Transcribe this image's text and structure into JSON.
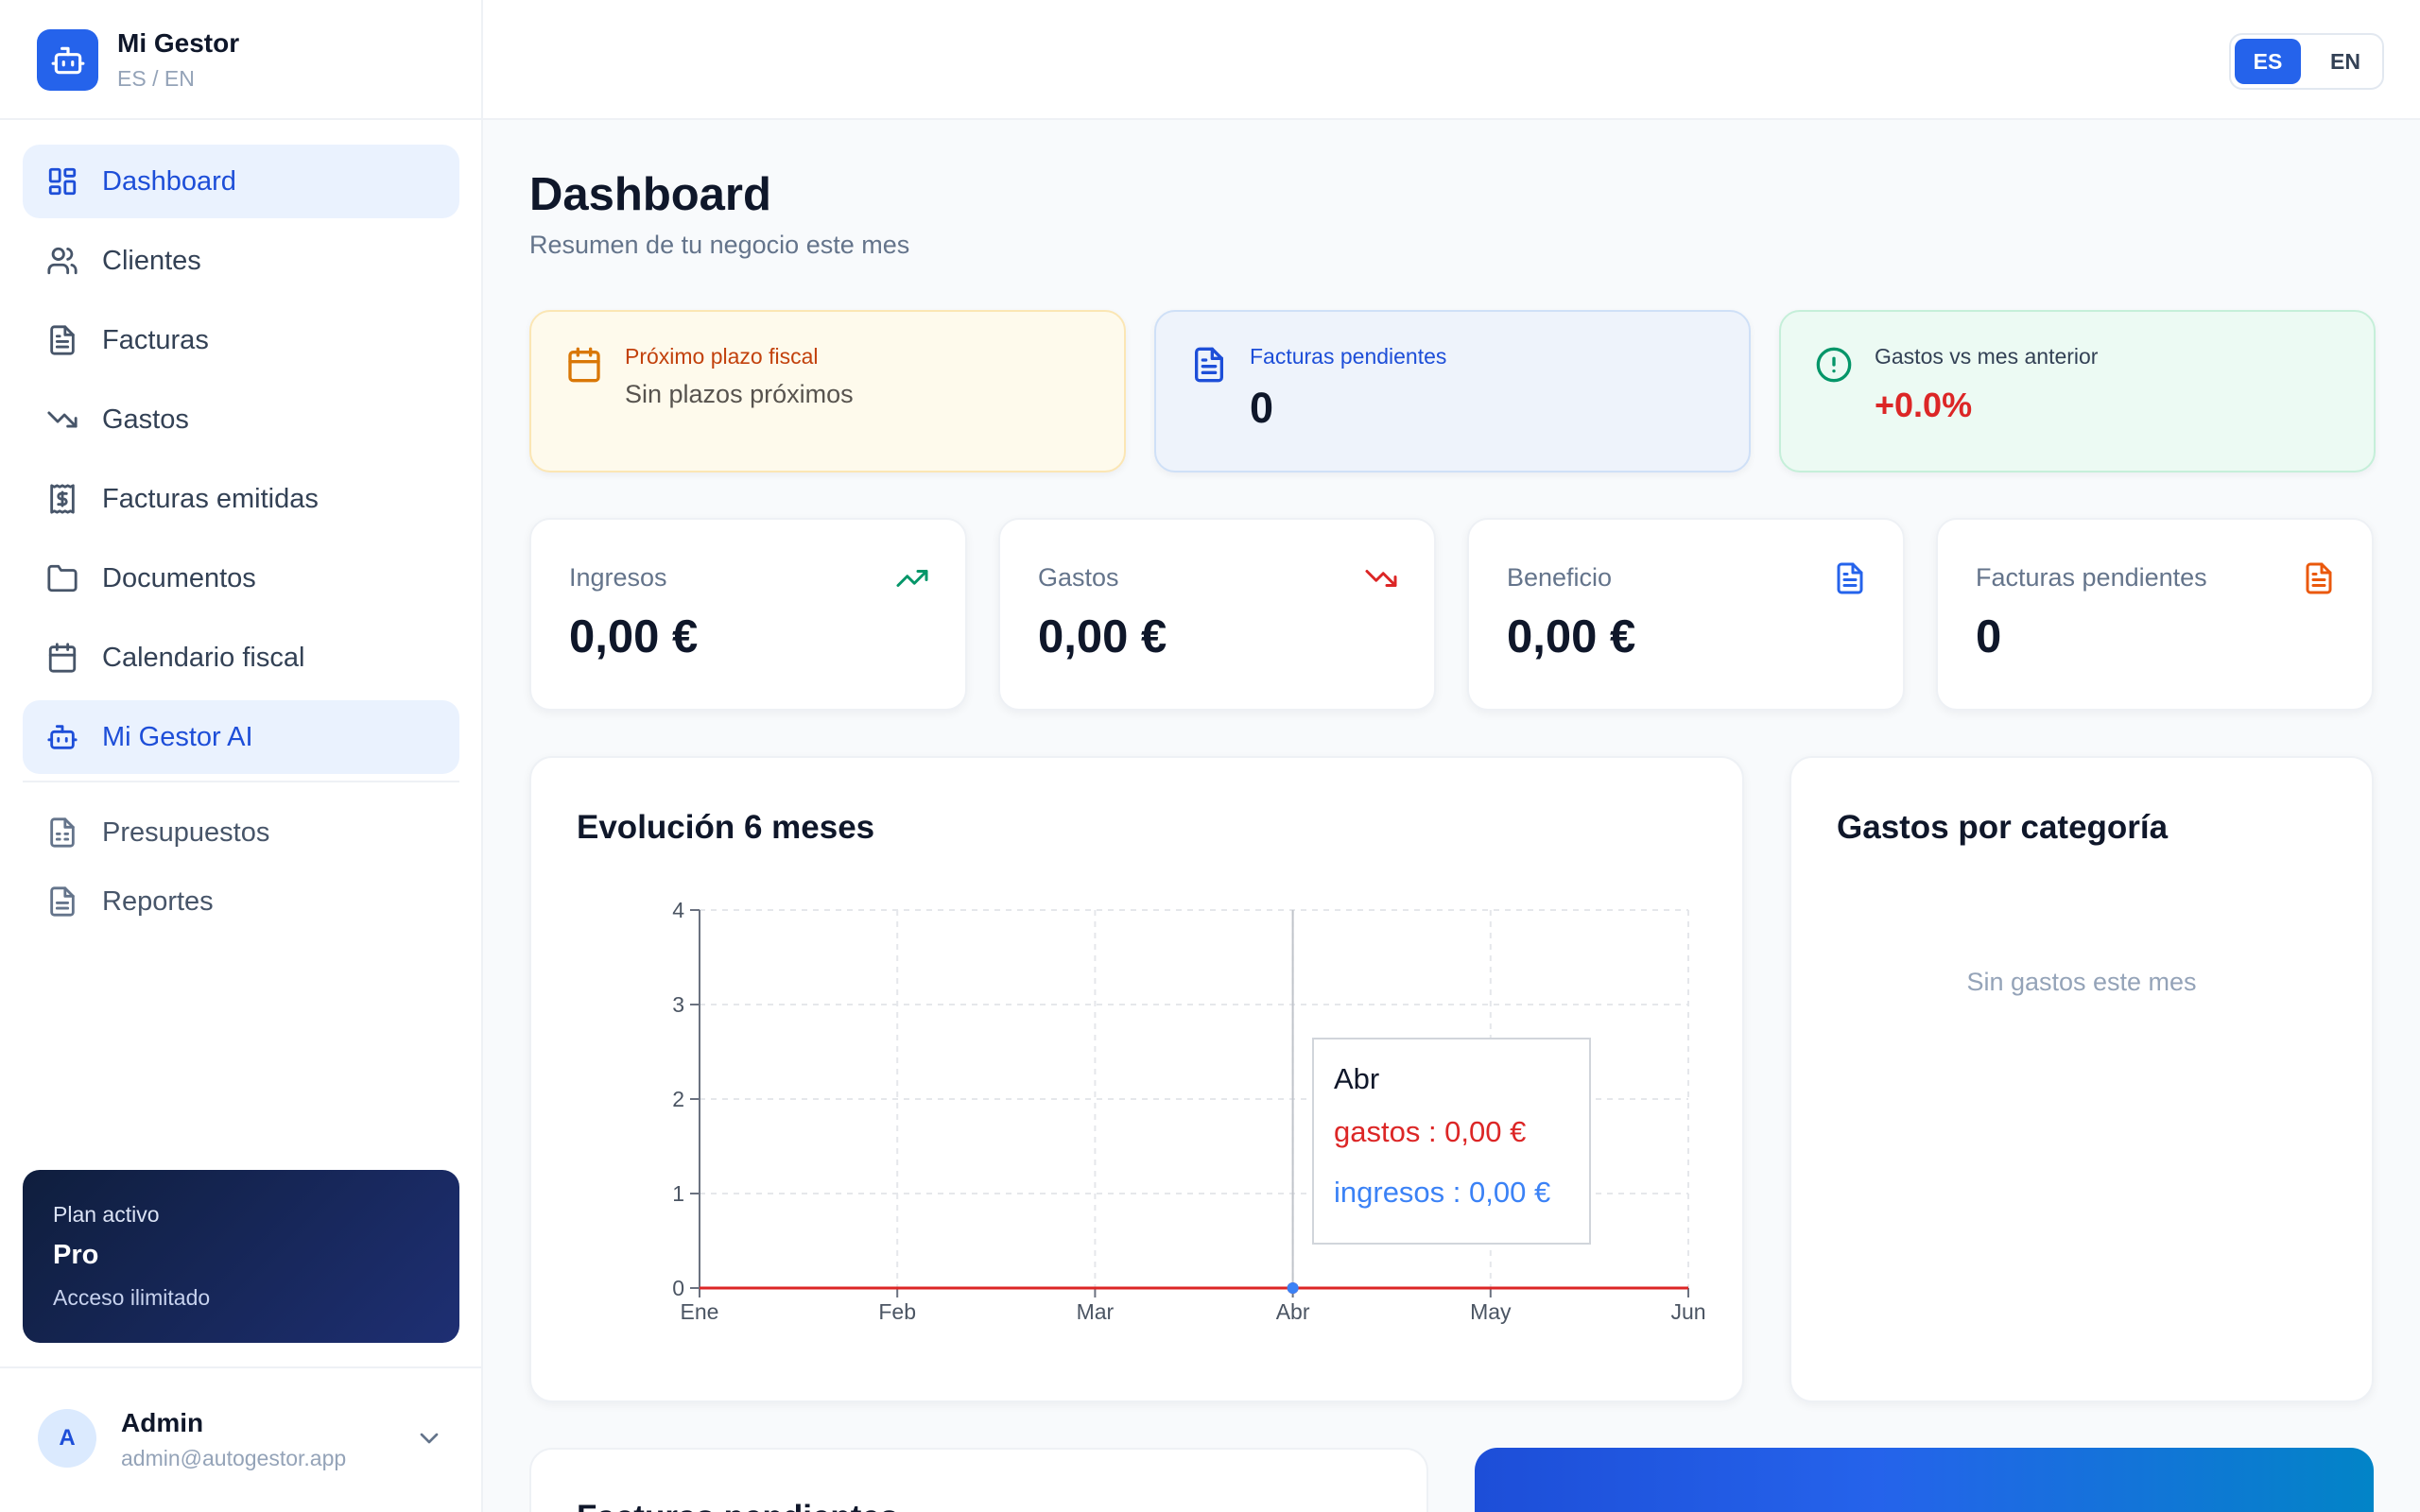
{
  "brand": {
    "name": "Mi Gestor",
    "subtitle": "ES / EN"
  },
  "sidebar": {
    "items": [
      {
        "label": "Dashboard",
        "icon": "dashboard-icon",
        "active": true
      },
      {
        "label": "Clientes",
        "icon": "users-icon"
      },
      {
        "label": "Facturas",
        "icon": "file-text-icon"
      },
      {
        "label": "Gastos",
        "icon": "trending-down-icon"
      },
      {
        "label": "Facturas emitidas",
        "icon": "receipt-icon"
      },
      {
        "label": "Documentos",
        "icon": "folder-icon"
      },
      {
        "label": "Calendario fiscal",
        "icon": "calendar-icon"
      },
      {
        "label": "Mi Gestor AI",
        "icon": "bot-icon",
        "highlighted": true
      }
    ],
    "secondary_items": [
      {
        "label": "Presupuestos",
        "icon": "file-spreadsheet-icon"
      },
      {
        "label": "Reportes",
        "icon": "file-report-icon"
      }
    ],
    "plan": {
      "label": "Plan activo",
      "name": "Pro",
      "description": "Acceso ilimitado"
    },
    "user": {
      "initial": "A",
      "name": "Admin",
      "email": "admin@autogestor.app"
    }
  },
  "topbar": {
    "languages": [
      "ES",
      "EN"
    ],
    "selected": "ES"
  },
  "page": {
    "title": "Dashboard",
    "subtitle": "Resumen de tu negocio este mes"
  },
  "alerts": [
    {
      "title": "Próximo plazo fiscal",
      "value": "Sin plazos próximos",
      "icon": "calendar-icon",
      "color": "#c2410c"
    },
    {
      "title": "Facturas pendientes",
      "value": "0",
      "icon": "file-text-icon",
      "color": "#1d4ed8"
    },
    {
      "title": "Gastos vs mes anterior",
      "value": "+0.0%",
      "icon": "alert-circle-icon",
      "color": "#059669"
    }
  ],
  "kpis": [
    {
      "label": "Ingresos",
      "value": "0,00 €",
      "icon": "trending-up-icon",
      "color": "#059669"
    },
    {
      "label": "Gastos",
      "value": "0,00 €",
      "icon": "trending-down-icon",
      "color": "#dc2626"
    },
    {
      "label": "Beneficio",
      "value": "0,00 €",
      "icon": "file-text-icon",
      "color": "#2563eb"
    },
    {
      "label": "Facturas pendientes",
      "value": "0",
      "icon": "file-text-icon",
      "color": "#ea580c"
    }
  ],
  "evolution": {
    "title": "Evolución 6 meses",
    "tooltip": {
      "label": "Abr",
      "gastos": "gastos : 0,00 €",
      "ingresos": "ingresos : 0,00 €"
    }
  },
  "categories": {
    "title": "Gastos por categoría",
    "empty": "Sin gastos este mes"
  },
  "bottom": {
    "left_title": "Facturas pendientes"
  },
  "chart_data": {
    "type": "line",
    "x": [
      "Ene",
      "Feb",
      "Mar",
      "Abr",
      "May",
      "Jun"
    ],
    "series": [
      {
        "name": "gastos",
        "values": [
          0,
          0,
          0,
          0,
          0,
          0
        ],
        "color": "#dc2626"
      },
      {
        "name": "ingresos",
        "values": [
          0,
          0,
          0,
          0,
          0,
          0
        ],
        "color": "#3b82f6"
      }
    ],
    "yticks": [
      0,
      1,
      2,
      3,
      4
    ],
    "ylim": [
      0,
      4
    ],
    "grid": true,
    "active_point": "Abr"
  }
}
